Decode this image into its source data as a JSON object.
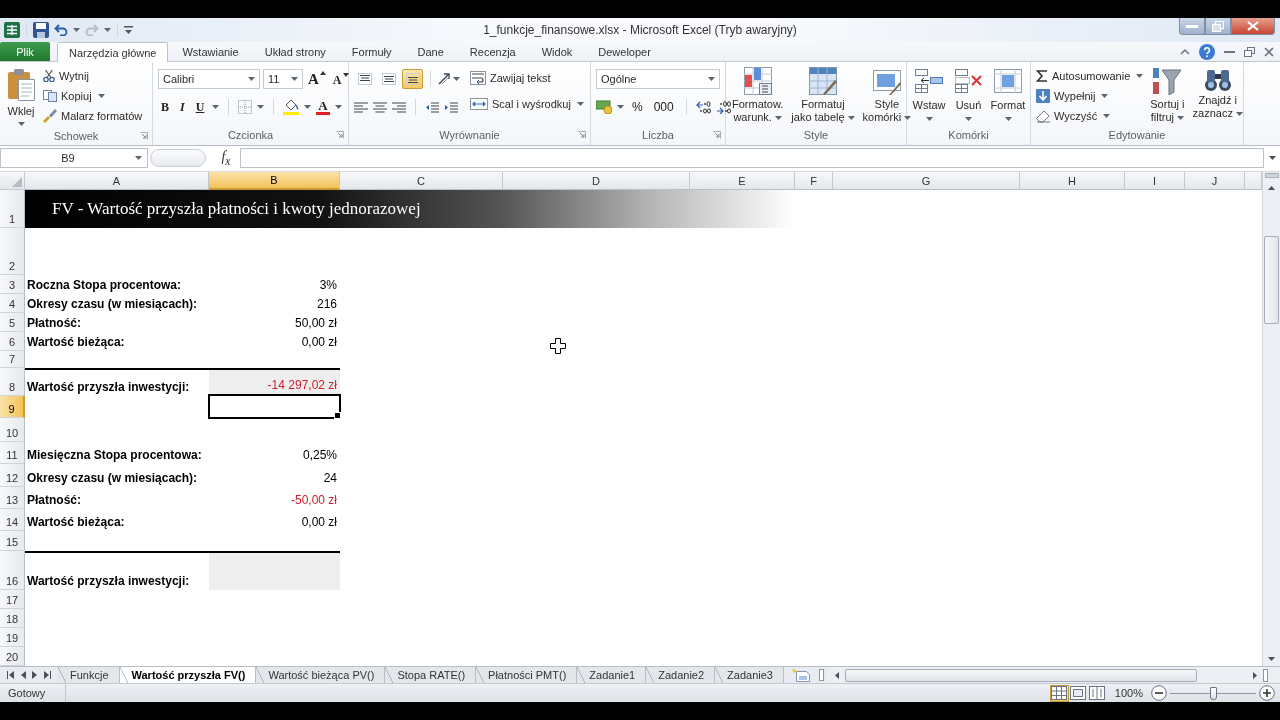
{
  "window": {
    "title": "1_funkcje_finansowe.xlsx - Microsoft Excel (Tryb awaryjny)"
  },
  "file_tab": "Plik",
  "ribbon_tabs": [
    {
      "label": "Narzędzia główne",
      "selected": true
    },
    {
      "label": "Wstawianie",
      "selected": false
    },
    {
      "label": "Układ strony",
      "selected": false
    },
    {
      "label": "Formuły",
      "selected": false
    },
    {
      "label": "Dane",
      "selected": false
    },
    {
      "label": "Recenzja",
      "selected": false
    },
    {
      "label": "Widok",
      "selected": false
    },
    {
      "label": "Deweloper",
      "selected": false
    }
  ],
  "ribbon_groups": [
    {
      "kind": "clipboard",
      "label": "Schowek",
      "paste": "Wklej",
      "cut": "Wytnij",
      "copy": "Kopiuj",
      "format_painter": "Malarz formatów"
    },
    {
      "kind": "font",
      "label": "Czcionka",
      "font_name": "Calibri",
      "font_size": "11",
      "grow_font": "A",
      "shrink_font": "A",
      "bold": "B",
      "italic": "I",
      "underline": "U",
      "font_color": "A"
    },
    {
      "kind": "alignment",
      "label": "Wyrównanie",
      "vertical_align": [
        {
          "selected": false
        },
        {
          "selected": false
        },
        {
          "selected": true
        }
      ],
      "wrap_text": "Zawijaj tekst",
      "merge_center": "Scal i wyśrodkuj"
    },
    {
      "kind": "number",
      "label": "Liczba",
      "format": "Ogólne",
      "percent": "%",
      "thousands": "000"
    },
    {
      "kind": "styles",
      "label": "Style",
      "buttons": [
        {
          "kind": "conditional",
          "lines": [
            "Formatow.",
            "warunk."
          ]
        },
        {
          "kind": "table",
          "lines": [
            "Formatuj",
            "jako tabelę"
          ]
        },
        {
          "kind": "cell_styles",
          "lines": [
            "Style",
            "komórki"
          ]
        }
      ]
    },
    {
      "kind": "cells",
      "label": "Komórki",
      "buttons": [
        {
          "kind": "insert",
          "label": "Wstaw"
        },
        {
          "kind": "delete",
          "label": "Usuń"
        },
        {
          "kind": "format",
          "label": "Format"
        }
      ]
    },
    {
      "kind": "editing",
      "label": "Edytowanie",
      "autosum": "Autosumowanie",
      "fill": "Wypełnij",
      "clear": "Wyczyść",
      "buttons": [
        {
          "kind": "sort",
          "lines": [
            "Sortuj i",
            "filtruj"
          ]
        },
        {
          "kind": "find",
          "lines": [
            "Znajdź i",
            "zaznacz"
          ]
        }
      ]
    }
  ],
  "formula_bar": {
    "name_box": "B9",
    "function_label": "f$_{x}$"
  },
  "sheet": {
    "columns": [
      {
        "label": "A",
        "selected": false
      },
      {
        "label": "B",
        "selected": true
      },
      {
        "label": "C",
        "selected": false
      },
      {
        "label": "D",
        "selected": false
      },
      {
        "label": "E",
        "selected": false
      },
      {
        "label": "F",
        "selected": false
      },
      {
        "label": "G",
        "selected": false
      },
      {
        "label": "H",
        "selected": false
      },
      {
        "label": "I",
        "selected": false
      },
      {
        "label": "J",
        "selected": false
      }
    ],
    "rows": [
      {
        "label": "1",
        "selected": false,
        "kind": "banner",
        "title": "FV - Wartość przyszła płatności i kwoty jednorazowej"
      },
      {
        "label": "2",
        "selected": false,
        "kind": "empty"
      },
      {
        "label": "3",
        "selected": false,
        "kind": "field",
        "title": "Roczna Stopa procentowa:",
        "value": "3%",
        "negative": false
      },
      {
        "label": "4",
        "selected": false,
        "kind": "field",
        "title": "Okresy czasu (w miesiącach):",
        "value": "216",
        "negative": false
      },
      {
        "label": "5",
        "selected": false,
        "kind": "field",
        "title": "Płatność:",
        "value": "50,00 zł",
        "negative": false
      },
      {
        "label": "6",
        "selected": false,
        "kind": "field",
        "title": "Wartość bieżąca:",
        "value": "0,00 zł",
        "negative": false
      },
      {
        "label": "7",
        "selected": false,
        "kind": "empty"
      },
      {
        "label": "8",
        "selected": false,
        "kind": "result",
        "title": "Wartość przyszła inwestycji:",
        "value": "-14 297,02 zł",
        "negative": true
      },
      {
        "label": "9",
        "selected": true,
        "kind": "empty"
      },
      {
        "label": "10",
        "selected": false,
        "kind": "empty"
      },
      {
        "label": "11",
        "selected": false,
        "kind": "field",
        "title": "Miesięczna Stopa procentowa:",
        "value": "0,25%",
        "negative": false
      },
      {
        "label": "12",
        "selected": false,
        "kind": "field",
        "title": "Okresy czasu (w miesiącach):",
        "value": "24",
        "negative": false
      },
      {
        "label": "13",
        "selected": false,
        "kind": "field",
        "title": "Płatność:",
        "value": "-50,00 zł",
        "negative": true
      },
      {
        "label": "14",
        "selected": false,
        "kind": "field",
        "title": "Wartość bieżąca:",
        "value": "0,00 zł",
        "negative": false
      },
      {
        "label": "15",
        "selected": false,
        "kind": "empty"
      },
      {
        "label": "16",
        "selected": false,
        "kind": "result",
        "title": "Wartość przyszła inwestycji:"
      },
      {
        "label": "17",
        "selected": false,
        "kind": "empty"
      },
      {
        "label": "18",
        "selected": false,
        "kind": "empty"
      },
      {
        "label": "19",
        "selected": false,
        "kind": "empty"
      },
      {
        "label": "20",
        "selected": false,
        "kind": "empty"
      }
    ]
  },
  "sheet_tabs": [
    {
      "label": "Funkcje",
      "selected": false
    },
    {
      "label": "Wartość przyszła FV()",
      "selected": true
    },
    {
      "label": "Wartość bieżąca PV()",
      "selected": false
    },
    {
      "label": "Stopa RATE()",
      "selected": false
    },
    {
      "label": "Płatności PMT()",
      "selected": false
    },
    {
      "label": "Zadanie1",
      "selected": false
    },
    {
      "label": "Zadanie2",
      "selected": false
    },
    {
      "label": "Zadanie3",
      "selected": false
    }
  ],
  "status_bar": {
    "status": "Gotowy",
    "views": [
      {
        "selected": true
      },
      {
        "selected": false
      },
      {
        "selected": false
      }
    ],
    "zoom": "100%",
    "zoom_slider": {
      "level": 0.5
    }
  }
}
